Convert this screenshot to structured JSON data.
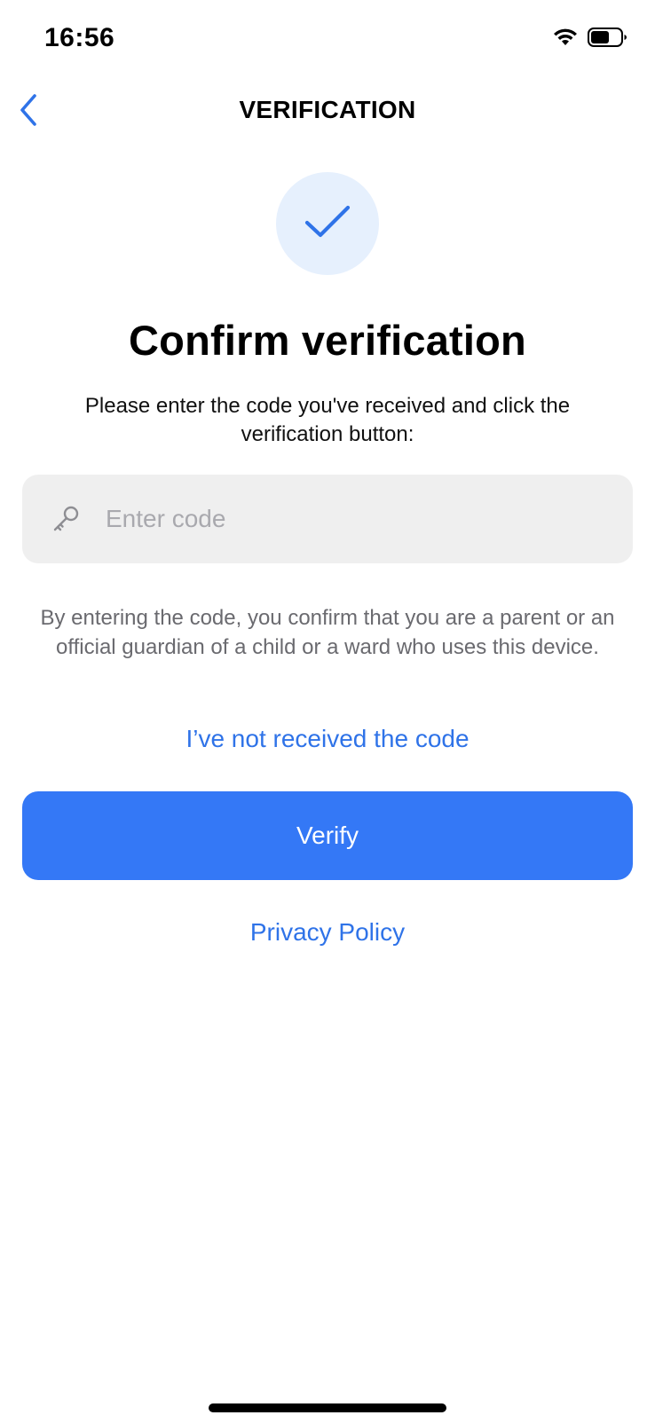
{
  "status_bar": {
    "time": "16:56",
    "icons": [
      "wifi-icon",
      "battery-icon"
    ]
  },
  "nav": {
    "title": "VERIFICATION",
    "back_icon": "chevron-left-icon"
  },
  "hero": {
    "icon": "checkmark-icon",
    "headline": "Confirm verification",
    "instructions": "Please enter the code you've received and click the verification button:"
  },
  "code_field": {
    "icon": "key-icon",
    "value": "",
    "placeholder": "Enter code"
  },
  "consent": {
    "text": "By entering the code, you confirm that you are a parent or an official guardian of a child or a ward who uses this device."
  },
  "links": {
    "resend": "I’ve not received the code",
    "privacy": "Privacy Policy"
  },
  "actions": {
    "verify_label": "Verify"
  },
  "colors": {
    "accent": "#3478F6",
    "link": "#2F73E8",
    "circle_bg": "#E6F0FD",
    "field_bg": "#EFEFEF",
    "secondary_text": "#6A6A6F",
    "placeholder": "#A9A9AE"
  }
}
